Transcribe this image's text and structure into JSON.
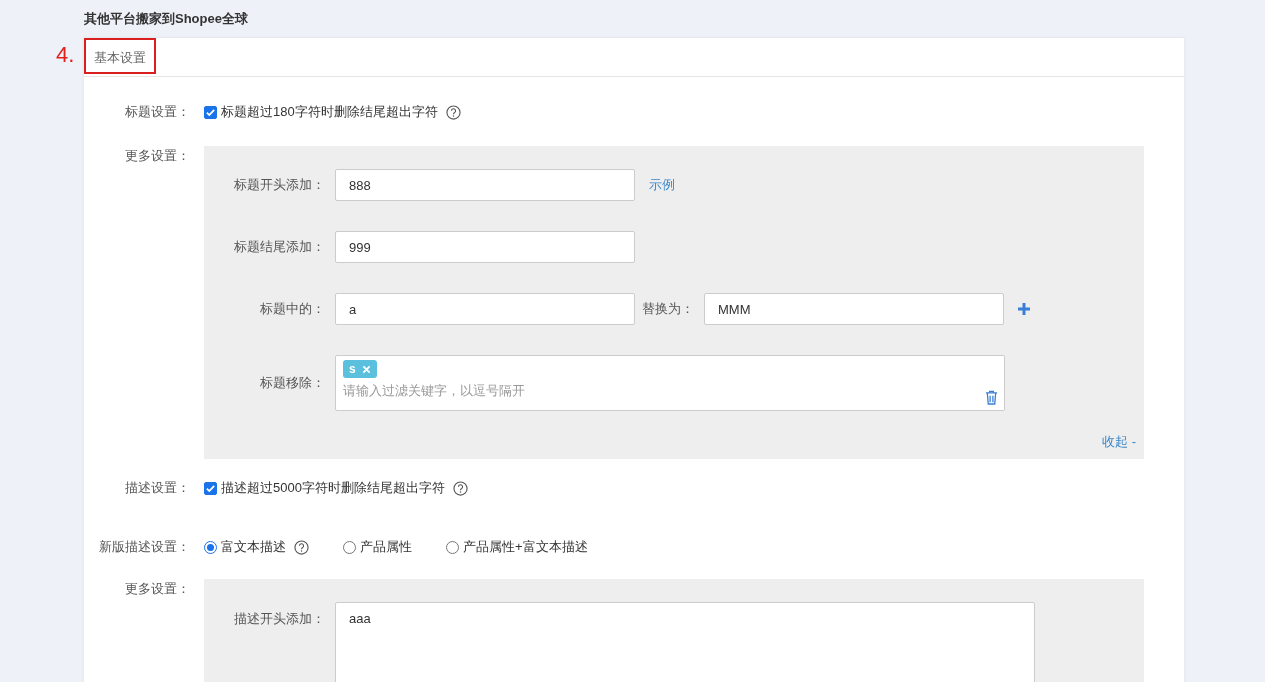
{
  "page_title": "其他平台搬家到Shopee全球",
  "annotation": "4.",
  "card": {
    "header": "基本设置",
    "title_setting": {
      "label": "标题设置：",
      "checked": true,
      "text": "标题超过180字符时删除结尾超出字符"
    },
    "title_more": {
      "label": "更多设置：",
      "rows": [
        {
          "kind": "input",
          "label": "标题开头添加：",
          "value": "888",
          "link": "示例"
        },
        {
          "kind": "input",
          "label": "标题结尾添加：",
          "value": "999"
        },
        {
          "kind": "replace",
          "label": "标题中的：",
          "value": "a",
          "label2": "替换为：",
          "value2": "MMM"
        },
        {
          "kind": "tags",
          "label": "标题移除：",
          "tags": [
            "s"
          ],
          "placeholder": "请输入过滤关键字，以逗号隔开"
        }
      ],
      "collapse": "收起 -"
    },
    "desc_setting": {
      "label": "描述设置：",
      "checked": true,
      "text": "描述超过5000字符时删除结尾超出字符"
    },
    "new_desc": {
      "label": "新版描述设置：",
      "options": [
        {
          "label": "富文本描述",
          "selected": true,
          "help": true
        },
        {
          "label": "产品属性",
          "selected": false,
          "help": false
        },
        {
          "label": "产品属性+富文本描述",
          "selected": false,
          "help": false
        }
      ]
    },
    "desc_more": {
      "label": "更多设置：",
      "rows": [
        {
          "kind": "textarea",
          "label": "描述开头添加：",
          "value": "aaa"
        }
      ]
    }
  }
}
